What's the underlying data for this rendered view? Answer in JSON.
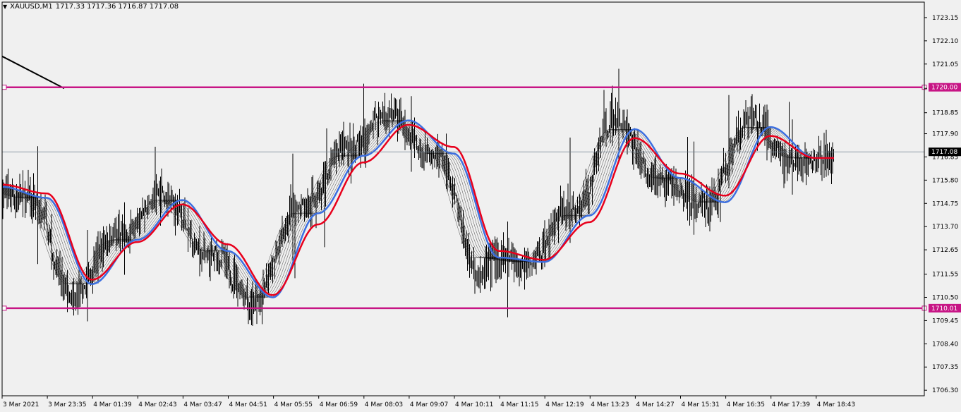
{
  "header": {
    "symbol": "XAUUSD,M1",
    "open": "1717.33",
    "high": "1717.36",
    "low": "1716.87",
    "close": "1717.08"
  },
  "colors": {
    "background": "#f0f0f0",
    "candles": "#000000",
    "level_lines": "#c71585",
    "fast_ma": "#e8001c",
    "slow_ma": "#3c6fe0",
    "ribbon": "#000000",
    "current_price_line": "#708090"
  },
  "chart_data": {
    "type": "line",
    "title": "",
    "y_axis": {
      "ticks": [
        "1723.15",
        "1722.10",
        "1721.05",
        "1719.95",
        "1718.85",
        "1717.90",
        "1716.85",
        "1715.80",
        "1714.75",
        "1713.70",
        "1712.65",
        "1711.55",
        "1710.50",
        "1709.45",
        "1708.40",
        "1707.35",
        "1706.30"
      ],
      "range": [
        1706.05,
        1723.85
      ]
    },
    "x_axis": {
      "ticks": [
        "3 Mar 2021",
        "3 Mar 23:35",
        "4 Mar 01:39",
        "4 Mar 02:43",
        "4 Mar 03:47",
        "4 Mar 04:51",
        "4 Mar 05:55",
        "4 Mar 06:59",
        "4 Mar 08:03",
        "4 Mar 09:07",
        "4 Mar 10:11",
        "4 Mar 11:15",
        "4 Mar 12:19",
        "4 Mar 13:23",
        "4 Mar 14:27",
        "4 Mar 15:31",
        "4 Mar 16:35",
        "4 Mar 17:39",
        "4 Mar 18:43"
      ]
    },
    "levels": [
      {
        "value": 1720.0,
        "label": "1720.00"
      },
      {
        "value": 1710.01,
        "label": "1710.01"
      }
    ],
    "current_price": {
      "value": 1717.08,
      "label": "1717.08"
    },
    "trendline": {
      "x": [
        "3 Mar 2021",
        "3 Mar 23:35"
      ],
      "y": [
        1721.4,
        1719.95
      ]
    },
    "series": [
      {
        "role": "fast_ma",
        "x": [
          "3 Mar 2021",
          "3 Mar 23:35",
          "4 Mar 01:39",
          "4 Mar 02:43",
          "4 Mar 03:47",
          "4 Mar 04:51",
          "4 Mar 05:55",
          "4 Mar 06:59",
          "4 Mar 08:03",
          "4 Mar 09:07",
          "4 Mar 10:11",
          "4 Mar 11:15",
          "4 Mar 12:19",
          "4 Mar 13:23",
          "4 Mar 14:27",
          "4 Mar 15:31",
          "4 Mar 16:35",
          "4 Mar 17:39",
          "4 Mar 18:43"
        ],
        "values": [
          1715.6,
          1715.2,
          1711.3,
          1713.0,
          1714.7,
          1712.9,
          1710.6,
          1713.8,
          1716.6,
          1718.3,
          1717.3,
          1712.6,
          1712.2,
          1713.9,
          1717.7,
          1716.1,
          1715.1,
          1717.8,
          1716.8
        ]
      },
      {
        "role": "slow_ma",
        "x": [
          "3 Mar 2021",
          "3 Mar 23:35",
          "4 Mar 01:39",
          "4 Mar 02:43",
          "4 Mar 03:47",
          "4 Mar 04:51",
          "4 Mar 05:55",
          "4 Mar 06:59",
          "4 Mar 08:03",
          "4 Mar 09:07",
          "4 Mar 10:11",
          "4 Mar 11:15",
          "4 Mar 12:19",
          "4 Mar 13:23",
          "4 Mar 14:27",
          "4 Mar 15:31",
          "4 Mar 16:35",
          "4 Mar 17:39",
          "4 Mar 18:43"
        ],
        "values": [
          1715.5,
          1715.0,
          1711.1,
          1713.1,
          1714.9,
          1712.6,
          1710.5,
          1714.3,
          1716.9,
          1718.5,
          1717.0,
          1712.3,
          1712.1,
          1714.2,
          1718.1,
          1715.9,
          1714.8,
          1718.2,
          1716.8
        ]
      }
    ]
  }
}
